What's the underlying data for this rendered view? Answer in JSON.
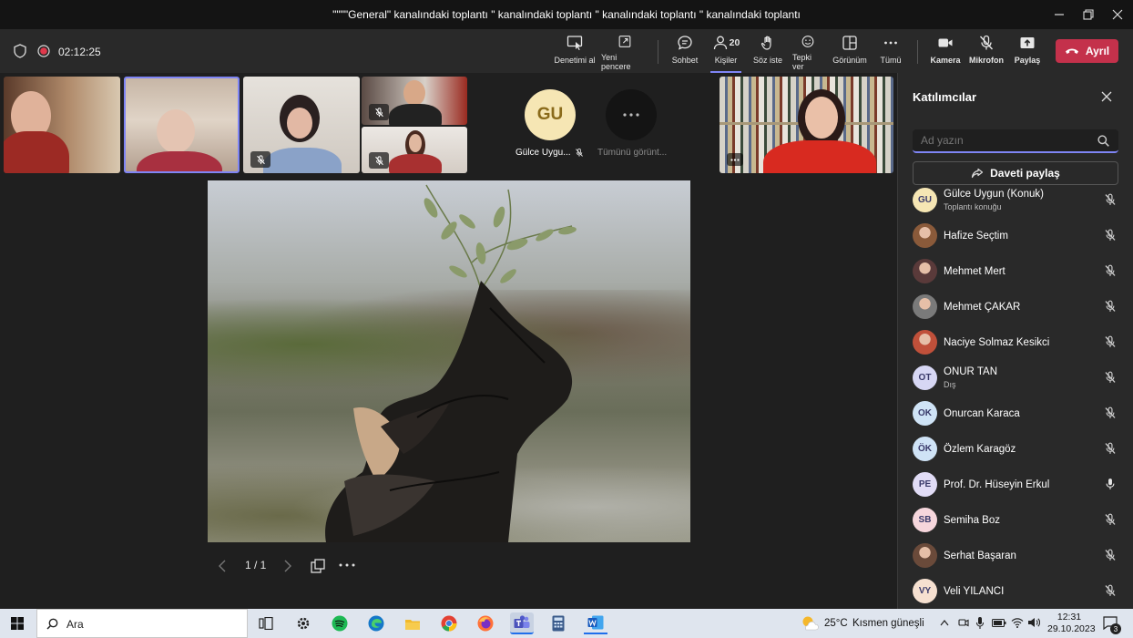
{
  "window": {
    "title": "\"\"\"\"General\" kanalındaki toplantı \" kanalındaki toplantı \" kanalındaki toplantı \" kanalındaki toplantı"
  },
  "meeting": {
    "timer": "02:12:25"
  },
  "toolbar": {
    "control": "Denetimi al",
    "new_window": "Yeni pencere",
    "chat": "Sohbet",
    "people": "Kişiler",
    "people_count": "20",
    "raise_hand": "Söz iste",
    "react": "Tepki ver",
    "view": "Görünüm",
    "more": "Tümü",
    "camera": "Kamera",
    "mic": "Mikrofon",
    "share": "Paylaş",
    "leave": "Ayrıl"
  },
  "gallery": {
    "gu_initials": "GU",
    "gu_name": "Gülce Uygu...",
    "view_all": "Tümünü görünt..."
  },
  "slide": {
    "page": "1 / 1"
  },
  "panel": {
    "title": "Katılımcılar",
    "search_placeholder": "Ad yazın",
    "invite": "Daveti paylaş",
    "participants": [
      {
        "initials": "GU",
        "name": "Gülce Uygun (Konuk)",
        "sub": "Toplantı konuğu",
        "avatar": "initials",
        "color": "#f6e6b4",
        "mic": "muted"
      },
      {
        "initials": "",
        "name": "Hafize Seçtim",
        "sub": "",
        "avatar": "photo",
        "color": "#8a5a3a",
        "mic": "muted"
      },
      {
        "initials": "",
        "name": "Mehmet Mert",
        "sub": "",
        "avatar": "photo",
        "color": "#5a3a3a",
        "mic": "muted"
      },
      {
        "initials": "",
        "name": "Mehmet ÇAKAR",
        "sub": "",
        "avatar": "photo",
        "color": "#7a7a7a",
        "mic": "muted"
      },
      {
        "initials": "",
        "name": "Naciye Solmaz Kesikci",
        "sub": "",
        "avatar": "photo",
        "color": "#c0503a",
        "mic": "muted"
      },
      {
        "initials": "OT",
        "name": "ONUR TAN",
        "sub": "Dış",
        "avatar": "initials",
        "color": "#d7d7f4",
        "mic": "muted"
      },
      {
        "initials": "OK",
        "name": "Onurcan Karaca",
        "sub": "",
        "avatar": "initials",
        "color": "#cfe3f6",
        "mic": "muted"
      },
      {
        "initials": "ÖK",
        "name": "Özlem Karagöz",
        "sub": "",
        "avatar": "initials",
        "color": "#cfe3f6",
        "mic": "muted"
      },
      {
        "initials": "PE",
        "name": "Prof. Dr. Hüseyin Erkul",
        "sub": "",
        "avatar": "initials",
        "color": "#e1dcf6",
        "mic": "on"
      },
      {
        "initials": "SB",
        "name": "Semiha Boz",
        "sub": "",
        "avatar": "initials",
        "color": "#f6d6dc",
        "mic": "muted"
      },
      {
        "initials": "",
        "name": "Serhat Başaran",
        "sub": "",
        "avatar": "photo",
        "color": "#6a4a3a",
        "mic": "muted"
      },
      {
        "initials": "VY",
        "name": "Veli YILANCI",
        "sub": "",
        "avatar": "initials",
        "color": "#f6e0d0",
        "mic": "muted"
      }
    ]
  },
  "taskbar": {
    "search": "Ara",
    "weather_temp": "25°C",
    "weather_text": "Kısmen güneşli",
    "time": "12:31",
    "date": "29.10.2023",
    "notif_count": "3"
  },
  "colors": {
    "accent": "#7f85f5",
    "leave": "#c4314b",
    "record": "#e0394c"
  },
  "icons": [
    "shield-icon",
    "record-icon",
    "control-icon",
    "popout-icon",
    "chat-icon",
    "people-icon",
    "hand-icon",
    "emoji-icon",
    "view-icon",
    "more-icon",
    "camera-icon",
    "mic-off-icon",
    "share-icon",
    "phone-icon",
    "close-icon",
    "search-icon",
    "share-invite-icon",
    "mic-icon",
    "windows-icon"
  ]
}
